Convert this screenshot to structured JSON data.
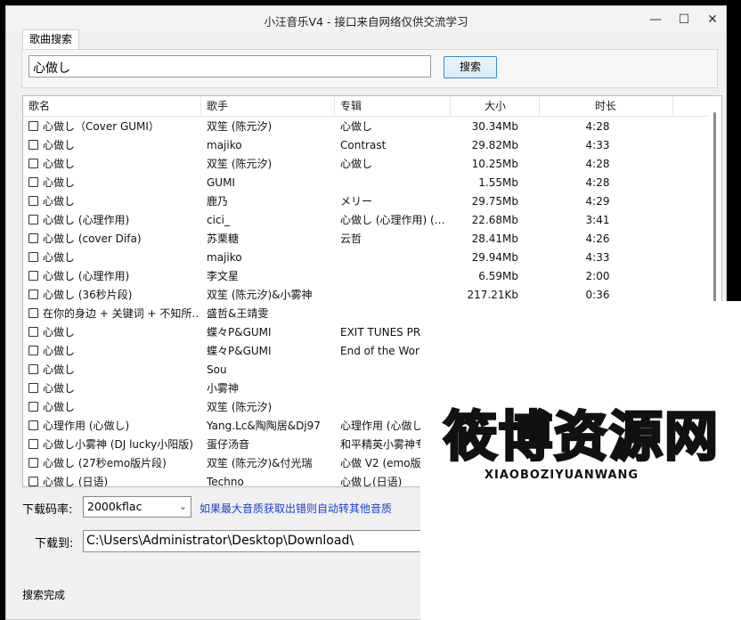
{
  "window": {
    "title": "小汪音乐V4 - 接口来自网络仅供交流学习"
  },
  "tabs": [
    {
      "label": "歌曲搜索"
    }
  ],
  "search": {
    "value": "心做し",
    "button_label": "搜索"
  },
  "table": {
    "columns": [
      "歌名",
      "歌手",
      "专辑",
      "大小",
      "时长"
    ],
    "rows": [
      {
        "name": "心做し（Cover GUMI）",
        "artist": "双笙 (陈元汐)",
        "album": "心做し",
        "size": "30.34Mb",
        "duration": "4:28"
      },
      {
        "name": "心做し",
        "artist": "majiko",
        "album": "Contrast",
        "size": "29.82Mb",
        "duration": "4:33"
      },
      {
        "name": "心做し",
        "artist": "双笙 (陈元汐)",
        "album": "心做し",
        "size": "10.25Mb",
        "duration": "4:28"
      },
      {
        "name": "心做し",
        "artist": "GUMI",
        "album": "",
        "size": "1.55Mb",
        "duration": "4:28"
      },
      {
        "name": "心做し",
        "artist": "鹿乃",
        "album": "メリー",
        "size": "29.75Mb",
        "duration": "4:29"
      },
      {
        "name": "心做し (心理作用)",
        "artist": "cici_",
        "album": "心做し (心理作用) (…",
        "size": "22.68Mb",
        "duration": "3:41"
      },
      {
        "name": "心做し (cover Difa)",
        "artist": "苏栗糖",
        "album": "云哲",
        "size": "28.41Mb",
        "duration": "4:26"
      },
      {
        "name": "心做し",
        "artist": "majiko",
        "album": "",
        "size": "29.94Mb",
        "duration": "4:33"
      },
      {
        "name": "心做し (心理作用)",
        "artist": "李文星",
        "album": "",
        "size": "6.59Mb",
        "duration": "2:00"
      },
      {
        "name": "心做し (36秒片段)",
        "artist": "双笙 (陈元汐)&小雾神",
        "album": "",
        "size": "217.21Kb",
        "duration": "0:36"
      },
      {
        "name": "在你的身边 + 关键词 + 不知所…",
        "artist": "盛哲&王靖雯",
        "album": "",
        "size": "",
        "duration": ""
      },
      {
        "name": "心做し",
        "artist": "蝶々P&GUMI",
        "album": "EXIT TUNES PR",
        "size": "",
        "duration": ""
      },
      {
        "name": "心做し",
        "artist": "蝶々P&GUMI",
        "album": "End of the Wor",
        "size": "",
        "duration": ""
      },
      {
        "name": "心做し",
        "artist": "Sou",
        "album": "",
        "size": "",
        "duration": ""
      },
      {
        "name": "心做し",
        "artist": "小雾神",
        "album": "",
        "size": "",
        "duration": ""
      },
      {
        "name": "心做し",
        "artist": "双笙 (陈元汐)",
        "album": "",
        "size": "",
        "duration": ""
      },
      {
        "name": "心理作用 (心做し)",
        "artist": "Yang.Lc&陶陶居&Dj97",
        "album": "心理作用 (心做し",
        "size": "",
        "duration": ""
      },
      {
        "name": "心做し小雾神 (DJ lucky小阳版)",
        "artist": "蛋仔汤音",
        "album": "和平精英小雾神专",
        "size": "",
        "duration": ""
      },
      {
        "name": "心做し (27秒emo版片段)",
        "artist": "双笙 (陈元汐)&付光瑞",
        "album": "心做 V2 (emo版",
        "size": "",
        "duration": ""
      },
      {
        "name": "心做し (日语)",
        "artist": "Techno",
        "album": "心做し(日语)",
        "size": "",
        "duration": ""
      }
    ]
  },
  "download": {
    "bitrate_label": "下载码率:",
    "bitrate_value": "2000kflac",
    "hint": "如果最大音质获取出错则自动转其他音质",
    "path_label": "下载到:",
    "path_value": "C:\\Users\\Administrator\\Desktop\\Download\\"
  },
  "status": "搜索完成",
  "watermark": {
    "logo": "筱博资源网",
    "sub": "XIAOBOZIYUANWANG",
    "color": "#f4b400"
  },
  "icons": {
    "minimize": "minimize-icon",
    "maximize": "maximize-icon",
    "close": "close-icon",
    "dropdown": "chevron-down-icon"
  }
}
